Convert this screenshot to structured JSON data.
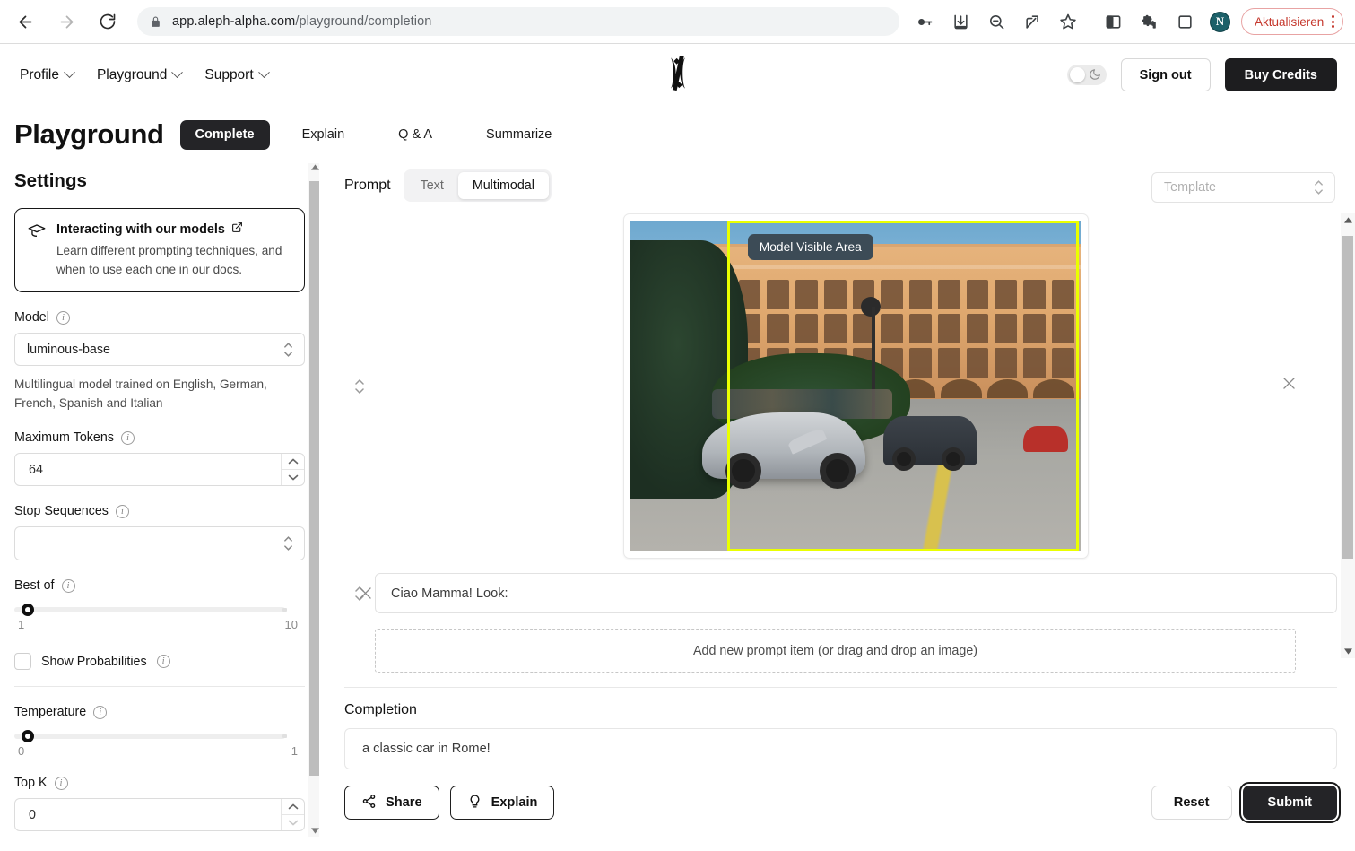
{
  "browser": {
    "url_prefix": "app.aleph-alpha.com",
    "url_suffix": "/playground/completion",
    "update_button": "Aktualisieren",
    "profile_initial": "N",
    "icons": [
      "back-arrow-icon",
      "forward-arrow-icon",
      "reload-icon",
      "lock-icon",
      "key-icon",
      "download-icon",
      "zoom-out-icon",
      "share-icon",
      "bookmark-star-icon",
      "side-panel-icon",
      "extensions-puzzle-icon",
      "reading-list-icon"
    ]
  },
  "header": {
    "nav": [
      {
        "label": "Profile"
      },
      {
        "label": "Playground"
      },
      {
        "label": "Support"
      }
    ],
    "sign_out": "Sign out",
    "buy_credits": "Buy Credits",
    "logo_name": "aleph-alpha-logo"
  },
  "page": {
    "title": "Playground",
    "tabs": [
      {
        "label": "Complete",
        "active": true
      },
      {
        "label": "Explain",
        "active": false
      },
      {
        "label": "Q & A",
        "active": false
      },
      {
        "label": "Summarize",
        "active": false
      }
    ]
  },
  "settings": {
    "heading": "Settings",
    "info_card": {
      "title": "Interacting with our models",
      "description": "Learn different prompting techniques, and when to use each one in our docs."
    },
    "model": {
      "label": "Model",
      "value": "luminous-base",
      "hint": "Multilingual model trained on English, German, French, Spanish and Italian"
    },
    "max_tokens": {
      "label": "Maximum Tokens",
      "value": "64"
    },
    "stop_sequences": {
      "label": "Stop Sequences",
      "value": ""
    },
    "best_of": {
      "label": "Best of",
      "min": "1",
      "max": "10",
      "value": 1
    },
    "show_probabilities": {
      "label": "Show Probabilities",
      "checked": false
    },
    "temperature": {
      "label": "Temperature",
      "min": "0",
      "max": "1",
      "value": 0
    },
    "top_k": {
      "label": "Top K",
      "value": "0"
    }
  },
  "prompt": {
    "label": "Prompt",
    "modes": [
      {
        "label": "Text",
        "active": false
      },
      {
        "label": "Multimodal",
        "active": true
      }
    ],
    "template_placeholder": "Template",
    "image_item": {
      "badge": "Model Visible Area",
      "alt": "classic silver Mercedes gullwing car in front of an ornate palazzo"
    },
    "text_item": {
      "value": "Ciao Mamma! Look:"
    },
    "dropzone": "Add new prompt item (or drag and drop an image)"
  },
  "completion": {
    "label": "Completion",
    "value": "a classic car in Rome!"
  },
  "actions": {
    "share": "Share",
    "explain": "Explain",
    "reset": "Reset",
    "submit": "Submit"
  },
  "colors": {
    "accent_dark": "#242427",
    "visible_area": "#eaff00",
    "badge_bg": "#3c4b56",
    "update_red": "#c5372c"
  }
}
